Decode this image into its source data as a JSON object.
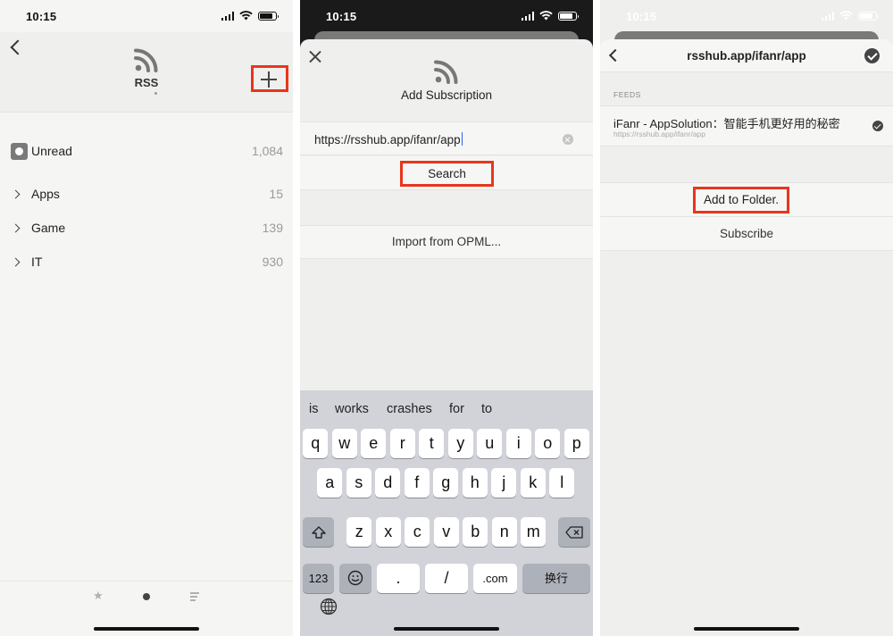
{
  "status": {
    "time": "10:15"
  },
  "panel1": {
    "title": "RSS",
    "unread": {
      "label": "Unread",
      "count": "1,084"
    },
    "folders": [
      {
        "label": "Apps",
        "count": "15"
      },
      {
        "label": "Game",
        "count": "139"
      },
      {
        "label": "IT",
        "count": "930"
      }
    ],
    "tabs": [
      "star-icon",
      "dot-icon",
      "list-icon"
    ]
  },
  "panel2": {
    "title": "Add Subscription",
    "url_value": "https://rsshub.app/ifanr/app",
    "search_label": "Search",
    "import_label": "Import from OPML...",
    "suggestions": [
      "is",
      "works",
      "crashes",
      "for",
      "to"
    ],
    "keys_row1": [
      "q",
      "w",
      "e",
      "r",
      "t",
      "y",
      "u",
      "i",
      "o",
      "p"
    ],
    "keys_row2": [
      "a",
      "s",
      "d",
      "f",
      "g",
      "h",
      "j",
      "k",
      "l"
    ],
    "keys_row3": [
      "z",
      "x",
      "c",
      "v",
      "b",
      "n",
      "m"
    ],
    "key_numbers": "123",
    "key_dot": ".",
    "key_slash": "/",
    "key_com": ".com",
    "key_return": "换行"
  },
  "panel3": {
    "nav_title": "rsshub.app/ifanr/app",
    "feeds_label": "FEEDS",
    "feed": {
      "title": "iFanr - AppSolution：智能手机更好用的秘密",
      "url": "https://rsshub.app/ifanr/app"
    },
    "add_folder_label": "Add to Folder.",
    "subscribe_label": "Subscribe"
  },
  "colors": {
    "highlight": "#e8361c",
    "caret": "#2c64f2"
  }
}
